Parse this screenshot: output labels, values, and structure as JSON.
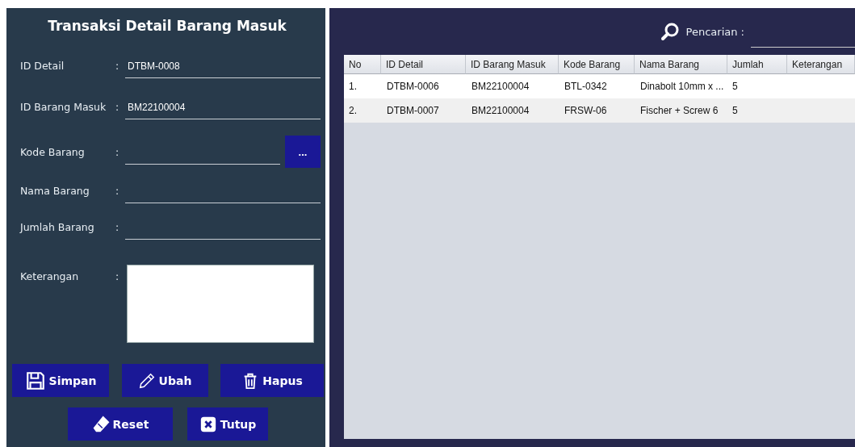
{
  "form": {
    "title": "Transaksi Detail Barang Masuk",
    "fields": [
      {
        "label": "ID Detail",
        "separator": ":",
        "kind": "line",
        "value": "DTBM-0008"
      },
      {
        "label": "ID Barang Masuk",
        "separator": ":",
        "kind": "line",
        "value": "BM22100004"
      },
      {
        "label": "Kode Barang",
        "separator": ":",
        "kind": "lookup",
        "button": "..."
      },
      {
        "label": "Nama Barang",
        "separator": ":",
        "kind": "line"
      },
      {
        "label": "Jumlah Barang",
        "separator": ":",
        "kind": "line"
      },
      {
        "label": "Keterangan",
        "separator": ":",
        "kind": "area"
      }
    ],
    "buttons": [
      [
        {
          "label": "Simpan",
          "kind": "save"
        },
        {
          "label": "Ubah",
          "kind": "edit"
        },
        {
          "label": "Hapus",
          "kind": "delete"
        }
      ],
      [
        {
          "label": "Reset",
          "kind": "reset"
        },
        {
          "label": "Tutup",
          "kind": "close"
        }
      ]
    ]
  },
  "search": {
    "label": "Pencarian :"
  },
  "table": {
    "columns": [
      "No",
      "ID Detail",
      "ID Barang Masuk",
      "Kode Barang",
      "Nama Barang",
      "Jumlah",
      "Keterangan"
    ],
    "rows": [
      [
        "1.",
        "DTBM-0006",
        "BM22100004",
        "BTL-0342",
        "Dinabolt 10mm x ...",
        "5"
      ],
      [
        "2.",
        "DTBM-0007",
        "BM22100004",
        "FRSW-06",
        "Fischer + Screw 6",
        "5"
      ]
    ]
  }
}
